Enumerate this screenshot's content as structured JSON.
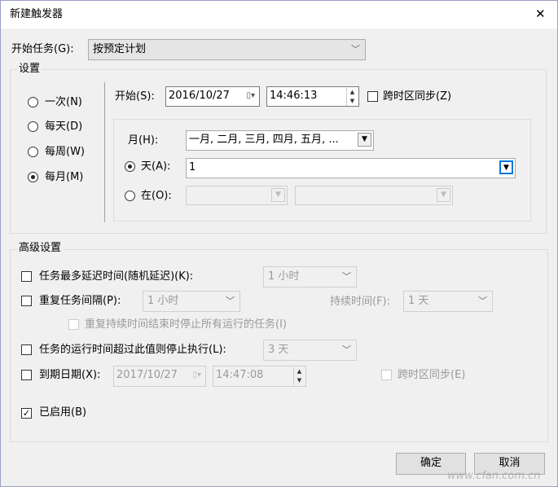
{
  "window": {
    "title": "新建触发器",
    "close": "✕"
  },
  "begin_task": {
    "label": "开始任务(G):",
    "value": "按预定计划"
  },
  "settings": {
    "legend": "设置",
    "schedule": [
      {
        "label": "一次(N)",
        "selected": false
      },
      {
        "label": "每天(D)",
        "selected": false
      },
      {
        "label": "每周(W)",
        "selected": false
      },
      {
        "label": "每月(M)",
        "selected": true
      }
    ],
    "start_label": "开始(S):",
    "start_date": "2016/10/27",
    "start_time": "14:46:13",
    "sync_tz_label": "跨时区同步(Z)",
    "months_label": "月(H):",
    "months_value": "一月, 二月, 三月, 四月, 五月, ...",
    "days_label": "天(A):",
    "days_value": "1",
    "on_label": "在(O):"
  },
  "advanced": {
    "legend": "高级设置",
    "delay_label": "任务最多延迟时间(随机延迟)(K):",
    "delay_value": "1 小时",
    "repeat_label": "重复任务间隔(P):",
    "repeat_value": "1 小时",
    "duration_label": "持续时间(F):",
    "duration_value": "1 天",
    "stop_all_label": "重复持续时间结束时停止所有运行的任务(I)",
    "stop_if_label": "任务的运行时间超过此值则停止执行(L):",
    "stop_if_value": "3 天",
    "expire_label": "到期日期(X):",
    "expire_date": "2017/10/27",
    "expire_time": "14:47:08",
    "expire_sync_label": "跨时区同步(E)",
    "enabled_label": "已启用(B)",
    "enabled": true
  },
  "buttons": {
    "ok": "确定",
    "cancel": "取消"
  },
  "watermark": "www.cfan.com.cn"
}
